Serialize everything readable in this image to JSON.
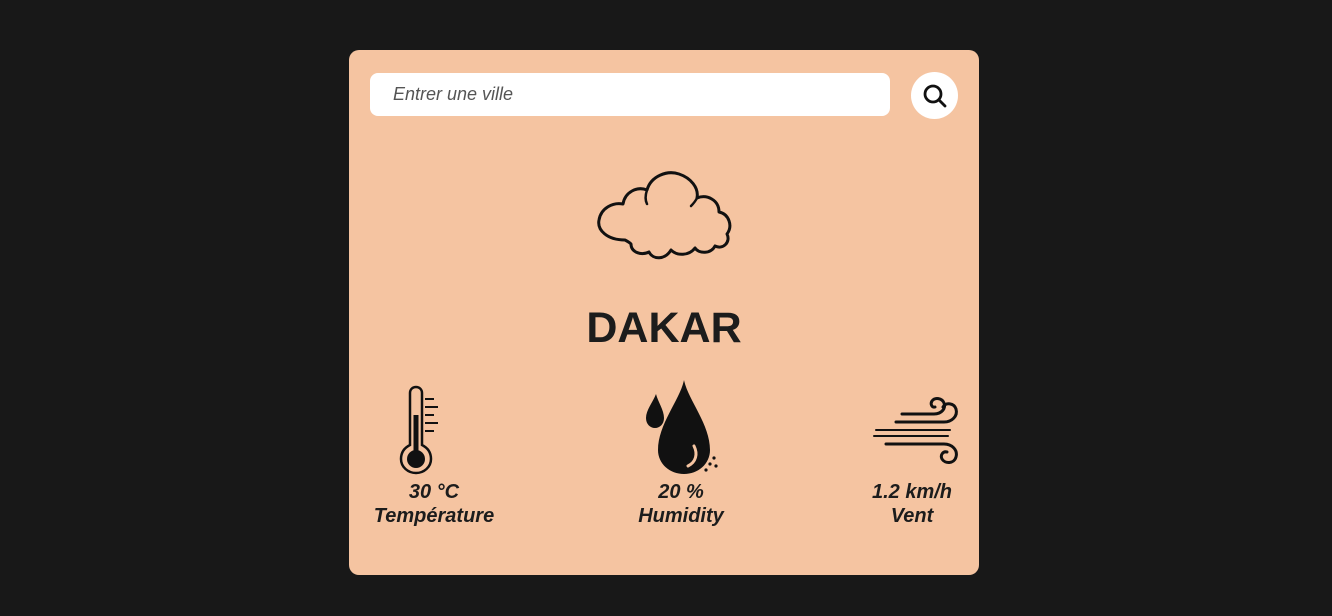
{
  "search": {
    "placeholder": "Entrer une ville",
    "value": "",
    "button_icon": "search-icon"
  },
  "weather": {
    "icon": "cloud-icon",
    "city": "DAKAR"
  },
  "stats": {
    "temperature": {
      "value": "30 °C",
      "label": "Température",
      "icon": "thermometer-icon"
    },
    "humidity": {
      "value": "20 %",
      "label": "Humidity",
      "icon": "water-drop-icon"
    },
    "wind": {
      "value": "1.2 km/h",
      "label": "Vent",
      "icon": "wind-icon"
    }
  },
  "colors": {
    "page_background": "#181818",
    "card_background": "#f5c4a1",
    "text": "#1c1c1c"
  }
}
